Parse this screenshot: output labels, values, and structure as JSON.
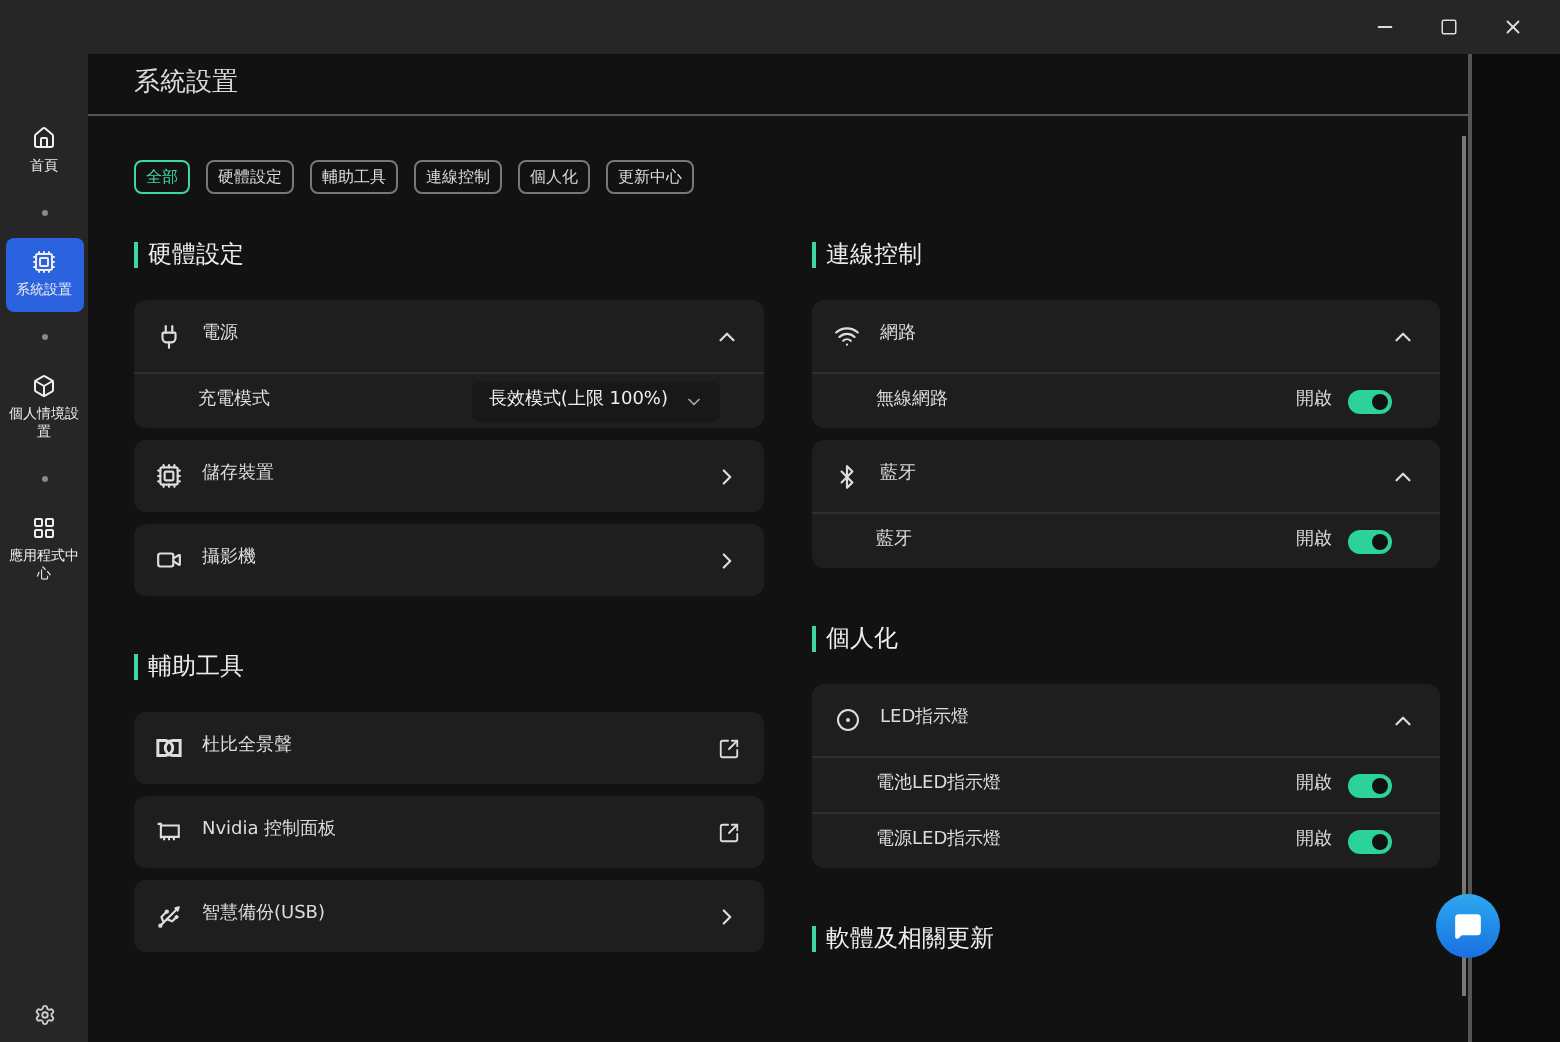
{
  "header": {
    "title": "系統設置"
  },
  "sidebar": {
    "items": [
      {
        "label": "首頁",
        "selected": false
      },
      {
        "label": "系統設置",
        "selected": true
      },
      {
        "label": "個人情境設置",
        "selected": false
      },
      {
        "label": "應用程式中心",
        "selected": false
      }
    ]
  },
  "filters": [
    {
      "label": "全部",
      "selected": true
    },
    {
      "label": "硬體設定",
      "selected": false
    },
    {
      "label": "輔助工具",
      "selected": false
    },
    {
      "label": "連線控制",
      "selected": false
    },
    {
      "label": "個人化",
      "selected": false
    },
    {
      "label": "更新中心",
      "selected": false
    }
  ],
  "left_sections": [
    {
      "title": "硬體設定",
      "cards": [
        {
          "label": "電源",
          "kind": "collapsible",
          "expanded": true,
          "rows": [
            {
              "kind": "select",
              "label": "充電模式",
              "value": "長效模式(上限 100%)"
            }
          ]
        },
        {
          "label": "儲存裝置",
          "kind": "page"
        },
        {
          "label": "攝影機",
          "kind": "page"
        }
      ]
    },
    {
      "title": "輔助工具",
      "cards": [
        {
          "label": "杜比全景聲",
          "kind": "external"
        },
        {
          "label": "Nvidia 控制面板",
          "kind": "external"
        },
        {
          "label": "智慧備份(USB)",
          "kind": "page"
        }
      ]
    }
  ],
  "right_sections": [
    {
      "title": "連線控制",
      "cards": [
        {
          "label": "網路",
          "kind": "collapsible",
          "expanded": true,
          "rows": [
            {
              "kind": "toggle",
              "label": "無線網路",
              "state_label": "開啟",
              "on": true
            }
          ]
        },
        {
          "label": "藍牙",
          "kind": "collapsible",
          "expanded": true,
          "rows": [
            {
              "kind": "toggle",
              "label": "藍牙",
              "state_label": "開啟",
              "on": true
            }
          ]
        }
      ]
    },
    {
      "title": "個人化",
      "cards": [
        {
          "label": "LED指示燈",
          "kind": "collapsible",
          "expanded": true,
          "rows": [
            {
              "kind": "toggle",
              "label": "電池LED指示燈",
              "state_label": "開啟",
              "on": true
            },
            {
              "kind": "toggle",
              "label": "電源LED指示燈",
              "state_label": "開啟",
              "on": true
            }
          ]
        }
      ]
    },
    {
      "title": "軟體及相關更新"
    }
  ]
}
